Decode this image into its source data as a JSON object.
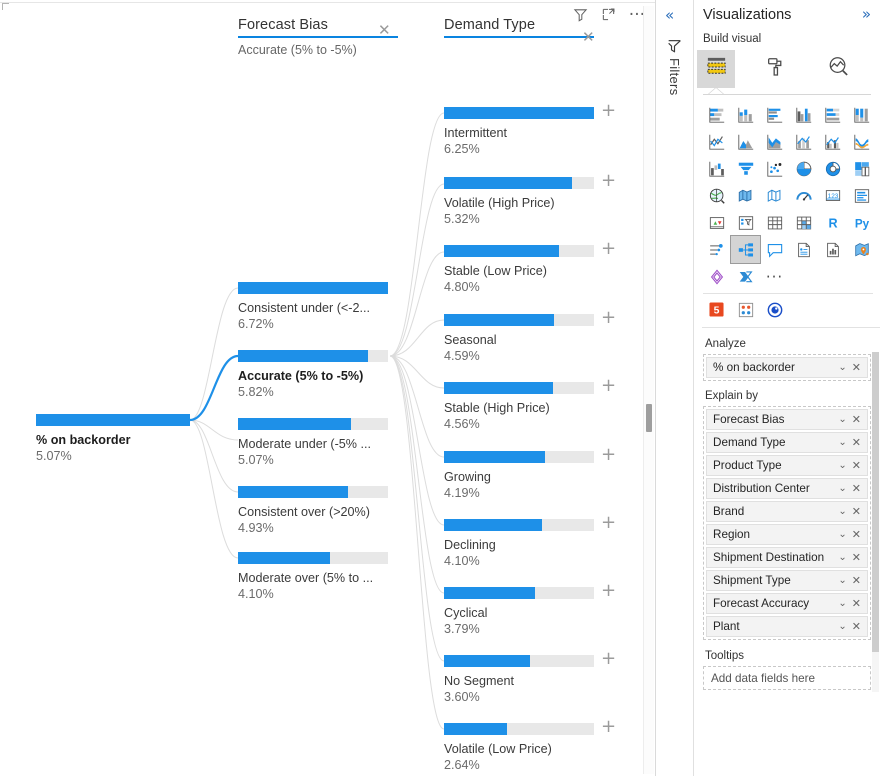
{
  "tree": {
    "columns": [
      {
        "title": "Forecast Bias",
        "subtitle": "Accurate (5% to -5%)",
        "close_icon": "close-icon"
      },
      {
        "title": "Demand Type",
        "subtitle": "",
        "close_icon": "close-icon"
      }
    ],
    "root": {
      "label": "% on backorder",
      "value": "5.07%"
    },
    "forecast_bias_nodes": [
      {
        "label": "Consistent under (<-2...",
        "value": "6.72%",
        "selected": false
      },
      {
        "label": "Accurate (5% to -5%)",
        "value": "5.82%",
        "selected": true
      },
      {
        "label": "Moderate under (-5% ...",
        "value": "5.07%",
        "selected": false
      },
      {
        "label": "Consistent over (>20%)",
        "value": "4.93%",
        "selected": false
      },
      {
        "label": "Moderate over (5% to ...",
        "value": "4.10%",
        "selected": false
      }
    ],
    "demand_type_nodes": [
      {
        "label": "Intermittent",
        "value": "6.25%"
      },
      {
        "label": "Volatile (High Price)",
        "value": "5.32%"
      },
      {
        "label": "Stable (Low Price)",
        "value": "4.80%"
      },
      {
        "label": "Seasonal",
        "value": "4.59%"
      },
      {
        "label": "Stable (High Price)",
        "value": "4.56%"
      },
      {
        "label": "Growing",
        "value": "4.19%"
      },
      {
        "label": "Declining",
        "value": "4.10%"
      },
      {
        "label": "Cyclical",
        "value": "3.79%"
      },
      {
        "label": "No Segment",
        "value": "3.60%"
      },
      {
        "label": "Volatile (Low Price)",
        "value": "2.64%"
      }
    ],
    "expand_glyph": "+",
    "header_icons": [
      "filter-icon",
      "focus-mode-icon",
      "more-options-icon"
    ],
    "more_options_glyph": "···"
  },
  "chart_data": {
    "type": "bar",
    "title": "% on backorder decomposition tree",
    "levels": [
      "% on backorder",
      "Forecast Bias",
      "Demand Type"
    ],
    "root": {
      "name": "% on backorder",
      "value": 5.07,
      "unit": "%"
    },
    "series": [
      {
        "name": "Forecast Bias",
        "categories": [
          "Consistent under (<-2...",
          "Accurate (5% to -5%)",
          "Moderate under (-5% ...",
          "Consistent over (>20%)",
          "Moderate over (5% to ..."
        ],
        "values": [
          6.72,
          5.82,
          5.07,
          4.93,
          4.1
        ],
        "selected": "Accurate (5% to -5%)"
      },
      {
        "name": "Demand Type",
        "categories": [
          "Intermittent",
          "Volatile (High Price)",
          "Stable (Low Price)",
          "Seasonal",
          "Stable (High Price)",
          "Growing",
          "Declining",
          "Cyclical",
          "No Segment",
          "Volatile (Low Price)"
        ],
        "values": [
          6.25,
          5.32,
          4.8,
          4.59,
          4.56,
          4.19,
          4.1,
          3.79,
          3.6,
          2.64
        ]
      }
    ],
    "ylabel": "% on backorder",
    "unit": "%",
    "grid": false,
    "legend": "none"
  },
  "filters_rail": {
    "collapse_glyph": "«",
    "label": "Filters",
    "icon": "filter-funnel-icon"
  },
  "viz_pane": {
    "title": "Visualizations",
    "expand_glyph": "»",
    "build_section_label": "Build visual",
    "tabs": [
      {
        "name": "build-visual-tab",
        "icon": "fields-table-icon",
        "active": true
      },
      {
        "name": "format-visual-tab",
        "icon": "paint-roller-icon",
        "active": false
      },
      {
        "name": "analytics-tab",
        "icon": "analytics-magnifier-icon",
        "active": false
      }
    ],
    "gallery": [
      [
        {
          "name": "stacked-bar-chart-icon"
        },
        {
          "name": "stacked-column-chart-icon"
        },
        {
          "name": "clustered-bar-chart-icon"
        },
        {
          "name": "clustered-column-chart-icon"
        },
        {
          "name": "100-stacked-bar-chart-icon"
        },
        {
          "name": "100-stacked-column-chart-icon"
        }
      ],
      [
        {
          "name": "line-chart-icon"
        },
        {
          "name": "area-chart-icon"
        },
        {
          "name": "stacked-area-chart-icon"
        },
        {
          "name": "line-stacked-column-chart-icon"
        },
        {
          "name": "line-clustered-column-chart-icon"
        },
        {
          "name": "ribbon-chart-icon"
        }
      ],
      [
        {
          "name": "waterfall-chart-icon"
        },
        {
          "name": "funnel-chart-icon"
        },
        {
          "name": "scatter-chart-icon"
        },
        {
          "name": "pie-chart-icon"
        },
        {
          "name": "donut-chart-icon"
        },
        {
          "name": "treemap-icon"
        }
      ],
      [
        {
          "name": "map-icon"
        },
        {
          "name": "filled-map-icon"
        },
        {
          "name": "shape-map-icon"
        },
        {
          "name": "gauge-icon"
        },
        {
          "name": "card-icon"
        },
        {
          "name": "multi-row-card-icon"
        }
      ],
      [
        {
          "name": "kpi-icon"
        },
        {
          "name": "slicer-icon"
        },
        {
          "name": "table-icon"
        },
        {
          "name": "matrix-icon"
        },
        {
          "name": "r-script-visual-icon"
        },
        {
          "name": "python-visual-icon"
        }
      ],
      [
        {
          "name": "key-influencers-icon"
        },
        {
          "name": "decomposition-tree-icon",
          "selected": true
        },
        {
          "name": "qa-visual-icon"
        },
        {
          "name": "smart-narrative-icon"
        },
        {
          "name": "paginated-report-icon"
        },
        {
          "name": "arcgis-maps-icon"
        }
      ],
      [
        {
          "name": "power-apps-icon"
        },
        {
          "name": "power-automate-icon"
        },
        {
          "name": "more-visuals-icon",
          "glyph": "···"
        }
      ]
    ],
    "custom_visuals": [
      {
        "name": "html-content-visual-icon"
      },
      {
        "name": "matrix-custom-visual-icon"
      },
      {
        "name": "play-axis-visual-icon"
      }
    ],
    "wells": [
      {
        "name": "analyze-well",
        "label": "Analyze",
        "fields": [
          {
            "name": "% on backorder",
            "chevron": "chevron-down-icon",
            "remove": "remove-field-icon"
          }
        ]
      },
      {
        "name": "explain-by-well",
        "label": "Explain by",
        "fields": [
          {
            "name": "Forecast Bias",
            "chevron": "chevron-down-icon",
            "remove": "remove-field-icon"
          },
          {
            "name": "Demand Type",
            "chevron": "chevron-down-icon",
            "remove": "remove-field-icon"
          },
          {
            "name": "Product Type",
            "chevron": "chevron-down-icon",
            "remove": "remove-field-icon"
          },
          {
            "name": "Distribution Center",
            "chevron": "chevron-down-icon",
            "remove": "remove-field-icon"
          },
          {
            "name": "Brand",
            "chevron": "chevron-down-icon",
            "remove": "remove-field-icon"
          },
          {
            "name": "Region",
            "chevron": "chevron-down-icon",
            "remove": "remove-field-icon"
          },
          {
            "name": "Shipment Destination",
            "chevron": "chevron-down-icon",
            "remove": "remove-field-icon"
          },
          {
            "name": "Shipment Type",
            "chevron": "chevron-down-icon",
            "remove": "remove-field-icon"
          },
          {
            "name": "Forecast Accuracy",
            "chevron": "chevron-down-icon",
            "remove": "remove-field-icon"
          },
          {
            "name": "Plant",
            "chevron": "chevron-down-icon",
            "remove": "remove-field-icon"
          }
        ]
      }
    ],
    "tooltips_label": "Tooltips",
    "tooltips_placeholder": "Add data fields here"
  },
  "colors": {
    "bar_fill": "#1e90e8",
    "bar_track": "#e8e8e8",
    "accent_underline": "#0a84e0",
    "link_line": "#d9d9d9",
    "link_line_active": "#1e90e8",
    "panel_bg": "#ffffff",
    "selected_tab_bg": "#d8d8d8"
  }
}
